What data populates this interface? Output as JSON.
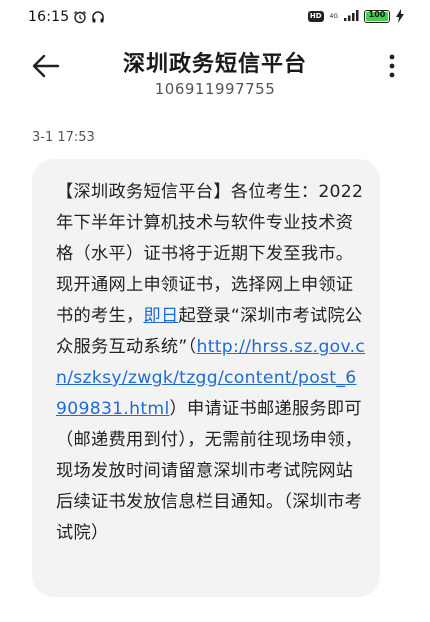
{
  "status_bar": {
    "time": "16:15",
    "alarm_icon": "alarm-clock-icon",
    "headset_icon": "headset-icon",
    "hd_label": "HD",
    "network_label": "4G",
    "signal_icon": "signal-bars-icon",
    "battery_level": "100",
    "charging_icon": "lightning-bolt-icon"
  },
  "header": {
    "back_icon": "back-arrow-icon",
    "title": "深圳政务短信平台",
    "phone_number": "106911997755",
    "more_icon": "more-vertical-icon"
  },
  "message": {
    "timestamp": "3-1 17:53",
    "text_before_date": "【深圳政务短信平台】各位考生：2022年下半年计算机技术与软件专业技术资格（水平）证书将于近期下发至我市。现开通网上申领证书，选择网上申领证书的考生，",
    "date_link": "即日",
    "text_after_date": "起登录“深圳市考试院公众服务互动系统”（",
    "url_link": "http://hrss.sz.gov.cn/szksy/zwgk/tzgg/content/post_6909831.html",
    "text_after_url": "）申请证书邮递服务即可（邮递费用到付），无需前往现场申领，现场发放时间请留意深圳市考试院网站后续证书发放信息栏目通知。（深圳市考试院）"
  },
  "colors": {
    "link": "#1f6cd6",
    "bubble_bg": "#f3f3f3",
    "battery_fill": "#3ecf4c"
  }
}
